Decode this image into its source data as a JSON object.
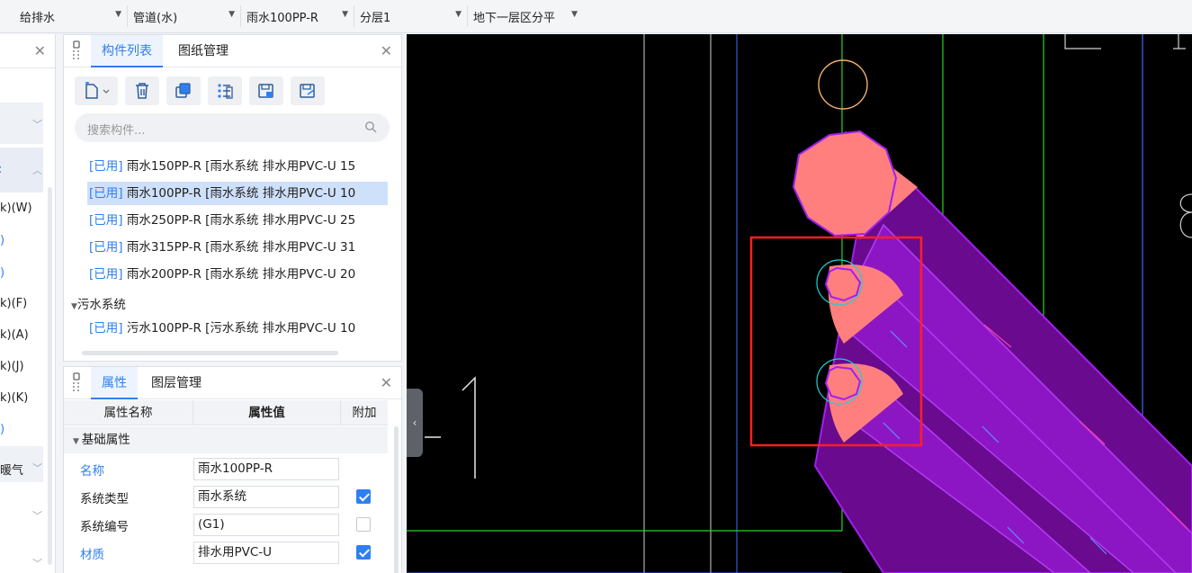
{
  "toolbar": {
    "discipline": "给排水",
    "type": "管道(水)",
    "component": "雨水100PP-R",
    "layer": "分层1",
    "floor": "地下一层区分平"
  },
  "left_panel": {
    "rows": [
      "k)(W)",
      ")",
      ")",
      "k)(F)",
      "k)(A)",
      "k)(J)",
      "k)(K)",
      ")",
      "暖气"
    ]
  },
  "component_panel": {
    "tab_list": "构件列表",
    "tab_drawings": "图纸管理",
    "search_placeholder": "搜索构件...",
    "items": [
      {
        "tag": "[已用]",
        "text": " 雨水150PP-R [雨水系统 排水用PVC-U 15"
      },
      {
        "tag": "[已用]",
        "text": " 雨水100PP-R [雨水系统 排水用PVC-U 10"
      },
      {
        "tag": "[已用]",
        "text": " 雨水250PP-R [雨水系统 排水用PVC-U 25"
      },
      {
        "tag": "[已用]",
        "text": " 雨水315PP-R [雨水系统 排水用PVC-U 31"
      },
      {
        "tag": "[已用]",
        "text": " 雨水200PP-R [雨水系统 排水用PVC-U 20"
      }
    ],
    "group_wastewater": "污水系统",
    "wastewater_items": [
      {
        "tag": "[已用]",
        "text": " 污水100PP-R [污水系统 排水用PVC-U 10"
      }
    ]
  },
  "properties_panel": {
    "tab_props": "属性",
    "tab_layers": "图层管理",
    "col_name": "属性名称",
    "col_value": "属性值",
    "col_extra": "附加",
    "section_basic": "基础属性",
    "rows": [
      {
        "name": "名称",
        "value": "雨水100PP-R",
        "checked": false,
        "has_checkbox": false,
        "blue": true
      },
      {
        "name": "系统类型",
        "value": "雨水系统",
        "checked": true,
        "has_checkbox": true,
        "blue": false
      },
      {
        "name": "系统编号",
        "value": "(G1)",
        "checked": false,
        "has_checkbox": true,
        "blue": false
      },
      {
        "name": "材质",
        "value": "排水用PVC-U",
        "checked": true,
        "has_checkbox": true,
        "blue": true
      }
    ]
  },
  "canvas": {
    "label_number": "1",
    "colors": {
      "background": "#000000",
      "pipe_fill": "#6a0a8f",
      "pipe_stroke": "#a020f0",
      "fitting_fill": "#ff7f7f",
      "grid_green": "#2bd12b",
      "grid_white": "#cfcfcf",
      "grid_blue": "#3a6bff",
      "selection_red": "#ff2020"
    }
  }
}
